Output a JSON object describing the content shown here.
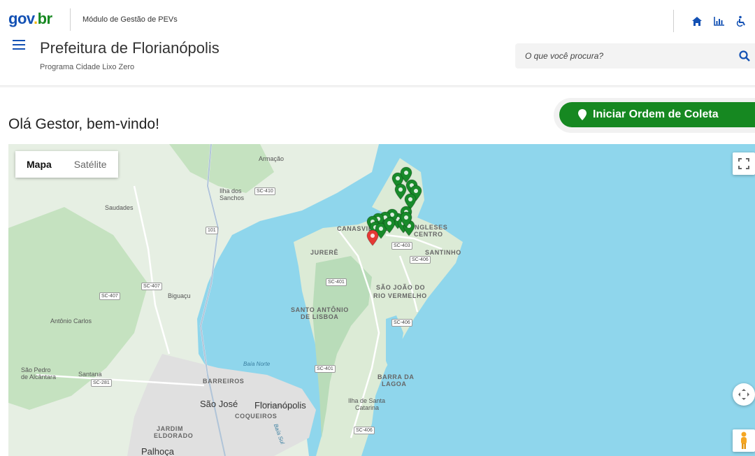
{
  "header": {
    "logo": {
      "part1": "gov",
      "part2": ".",
      "part3": "br"
    },
    "module_title": "Módulo de Gestão de PEVs",
    "org_title": "Prefeitura de Florianópolis",
    "org_subtitle": "Programa Cidade Lixo Zero",
    "search_placeholder": "O que você procura?",
    "icons": [
      "home-icon",
      "chart-icon",
      "accessibility-icon",
      "menu-icon",
      "search-icon"
    ]
  },
  "main": {
    "welcome": "Olá Gestor, bem-vindo!",
    "cta_label": "Iniciar Ordem de Coleta"
  },
  "map": {
    "type_buttons": [
      "Mapa",
      "Satélite"
    ],
    "labels": {
      "armacao": "Armação",
      "ilha_sanchos": "Ilha dos",
      "ilha_sanchos2": "Sanchos",
      "saudades": "Saudades",
      "biguacu": "Biguaçu",
      "antonio_carlos": "Antônio Carlos",
      "sao_pedro": "São Pedro",
      "sao_pedro2": "de Alcântara",
      "santana": "Santana",
      "barreiros": "BARREIROS",
      "sao_jose": "São José",
      "florianopolis": "Florianópolis",
      "coqueiros": "COQUEIROS",
      "jardim": "JARDIM",
      "eldorado": "ELDORADO",
      "palhoca": "Palhoça",
      "canasvieiras": "CANASVIEIRAS",
      "ingleses": "INGLESES",
      "centro": "CENTRO",
      "santinho": "SANTINHO",
      "jurere": "JURERÊ",
      "sjrv1": "SÃO JOÃO DO",
      "sjrv2": "RIO VERMELHO",
      "santo_antonio1": "SANTO ANTÔNIO",
      "santo_antonio2": "DE LISBOA",
      "barra1": "BARRA DA",
      "barra2": "LAGOA",
      "ilha_santa1": "Ilha de Santa",
      "ilha_santa2": "Catarina",
      "baia_norte": "Baía Norte",
      "baia_sul": "Baía Sul"
    },
    "roads": {
      "r1": "SC-410",
      "r2": "101",
      "r3": "SC-407",
      "r4": "SC-407",
      "r5": "SC-403",
      "r6": "SC-406",
      "r7": "SC-401",
      "r8": "SC-406",
      "r9": "SC-281",
      "r10": "SC-401",
      "r11": "SC-406"
    },
    "colors": {
      "water": "#8fd6ec",
      "land": "#e6efe3",
      "green_area": "#b9dcb9",
      "urban": "#e2e2e2",
      "pin_green": "#188a2a",
      "pin_red": "#e53935"
    }
  }
}
